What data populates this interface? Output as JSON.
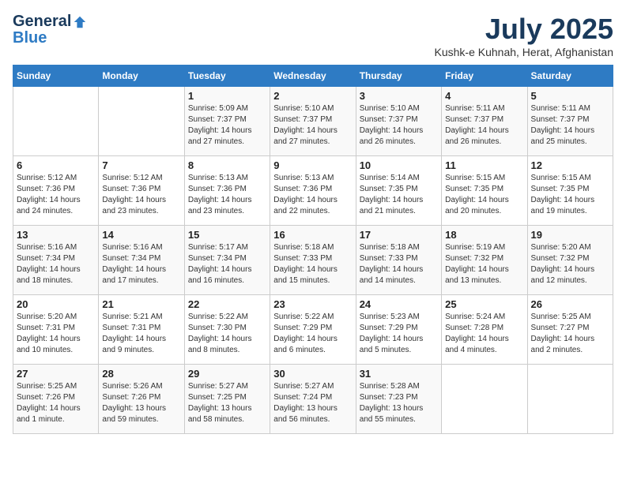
{
  "header": {
    "logo_general": "General",
    "logo_blue": "Blue",
    "month_title": "July 2025",
    "location": "Kushk-e Kuhnah, Herat, Afghanistan"
  },
  "weekdays": [
    "Sunday",
    "Monday",
    "Tuesday",
    "Wednesday",
    "Thursday",
    "Friday",
    "Saturday"
  ],
  "weeks": [
    [
      {
        "day": "",
        "info": ""
      },
      {
        "day": "",
        "info": ""
      },
      {
        "day": "1",
        "info": "Sunrise: 5:09 AM\nSunset: 7:37 PM\nDaylight: 14 hours and 27 minutes."
      },
      {
        "day": "2",
        "info": "Sunrise: 5:10 AM\nSunset: 7:37 PM\nDaylight: 14 hours and 27 minutes."
      },
      {
        "day": "3",
        "info": "Sunrise: 5:10 AM\nSunset: 7:37 PM\nDaylight: 14 hours and 26 minutes."
      },
      {
        "day": "4",
        "info": "Sunrise: 5:11 AM\nSunset: 7:37 PM\nDaylight: 14 hours and 26 minutes."
      },
      {
        "day": "5",
        "info": "Sunrise: 5:11 AM\nSunset: 7:37 PM\nDaylight: 14 hours and 25 minutes."
      }
    ],
    [
      {
        "day": "6",
        "info": "Sunrise: 5:12 AM\nSunset: 7:36 PM\nDaylight: 14 hours and 24 minutes."
      },
      {
        "day": "7",
        "info": "Sunrise: 5:12 AM\nSunset: 7:36 PM\nDaylight: 14 hours and 23 minutes."
      },
      {
        "day": "8",
        "info": "Sunrise: 5:13 AM\nSunset: 7:36 PM\nDaylight: 14 hours and 23 minutes."
      },
      {
        "day": "9",
        "info": "Sunrise: 5:13 AM\nSunset: 7:36 PM\nDaylight: 14 hours and 22 minutes."
      },
      {
        "day": "10",
        "info": "Sunrise: 5:14 AM\nSunset: 7:35 PM\nDaylight: 14 hours and 21 minutes."
      },
      {
        "day": "11",
        "info": "Sunrise: 5:15 AM\nSunset: 7:35 PM\nDaylight: 14 hours and 20 minutes."
      },
      {
        "day": "12",
        "info": "Sunrise: 5:15 AM\nSunset: 7:35 PM\nDaylight: 14 hours and 19 minutes."
      }
    ],
    [
      {
        "day": "13",
        "info": "Sunrise: 5:16 AM\nSunset: 7:34 PM\nDaylight: 14 hours and 18 minutes."
      },
      {
        "day": "14",
        "info": "Sunrise: 5:16 AM\nSunset: 7:34 PM\nDaylight: 14 hours and 17 minutes."
      },
      {
        "day": "15",
        "info": "Sunrise: 5:17 AM\nSunset: 7:34 PM\nDaylight: 14 hours and 16 minutes."
      },
      {
        "day": "16",
        "info": "Sunrise: 5:18 AM\nSunset: 7:33 PM\nDaylight: 14 hours and 15 minutes."
      },
      {
        "day": "17",
        "info": "Sunrise: 5:18 AM\nSunset: 7:33 PM\nDaylight: 14 hours and 14 minutes."
      },
      {
        "day": "18",
        "info": "Sunrise: 5:19 AM\nSunset: 7:32 PM\nDaylight: 14 hours and 13 minutes."
      },
      {
        "day": "19",
        "info": "Sunrise: 5:20 AM\nSunset: 7:32 PM\nDaylight: 14 hours and 12 minutes."
      }
    ],
    [
      {
        "day": "20",
        "info": "Sunrise: 5:20 AM\nSunset: 7:31 PM\nDaylight: 14 hours and 10 minutes."
      },
      {
        "day": "21",
        "info": "Sunrise: 5:21 AM\nSunset: 7:31 PM\nDaylight: 14 hours and 9 minutes."
      },
      {
        "day": "22",
        "info": "Sunrise: 5:22 AM\nSunset: 7:30 PM\nDaylight: 14 hours and 8 minutes."
      },
      {
        "day": "23",
        "info": "Sunrise: 5:22 AM\nSunset: 7:29 PM\nDaylight: 14 hours and 6 minutes."
      },
      {
        "day": "24",
        "info": "Sunrise: 5:23 AM\nSunset: 7:29 PM\nDaylight: 14 hours and 5 minutes."
      },
      {
        "day": "25",
        "info": "Sunrise: 5:24 AM\nSunset: 7:28 PM\nDaylight: 14 hours and 4 minutes."
      },
      {
        "day": "26",
        "info": "Sunrise: 5:25 AM\nSunset: 7:27 PM\nDaylight: 14 hours and 2 minutes."
      }
    ],
    [
      {
        "day": "27",
        "info": "Sunrise: 5:25 AM\nSunset: 7:26 PM\nDaylight: 14 hours and 1 minute."
      },
      {
        "day": "28",
        "info": "Sunrise: 5:26 AM\nSunset: 7:26 PM\nDaylight: 13 hours and 59 minutes."
      },
      {
        "day": "29",
        "info": "Sunrise: 5:27 AM\nSunset: 7:25 PM\nDaylight: 13 hours and 58 minutes."
      },
      {
        "day": "30",
        "info": "Sunrise: 5:27 AM\nSunset: 7:24 PM\nDaylight: 13 hours and 56 minutes."
      },
      {
        "day": "31",
        "info": "Sunrise: 5:28 AM\nSunset: 7:23 PM\nDaylight: 13 hours and 55 minutes."
      },
      {
        "day": "",
        "info": ""
      },
      {
        "day": "",
        "info": ""
      }
    ]
  ]
}
